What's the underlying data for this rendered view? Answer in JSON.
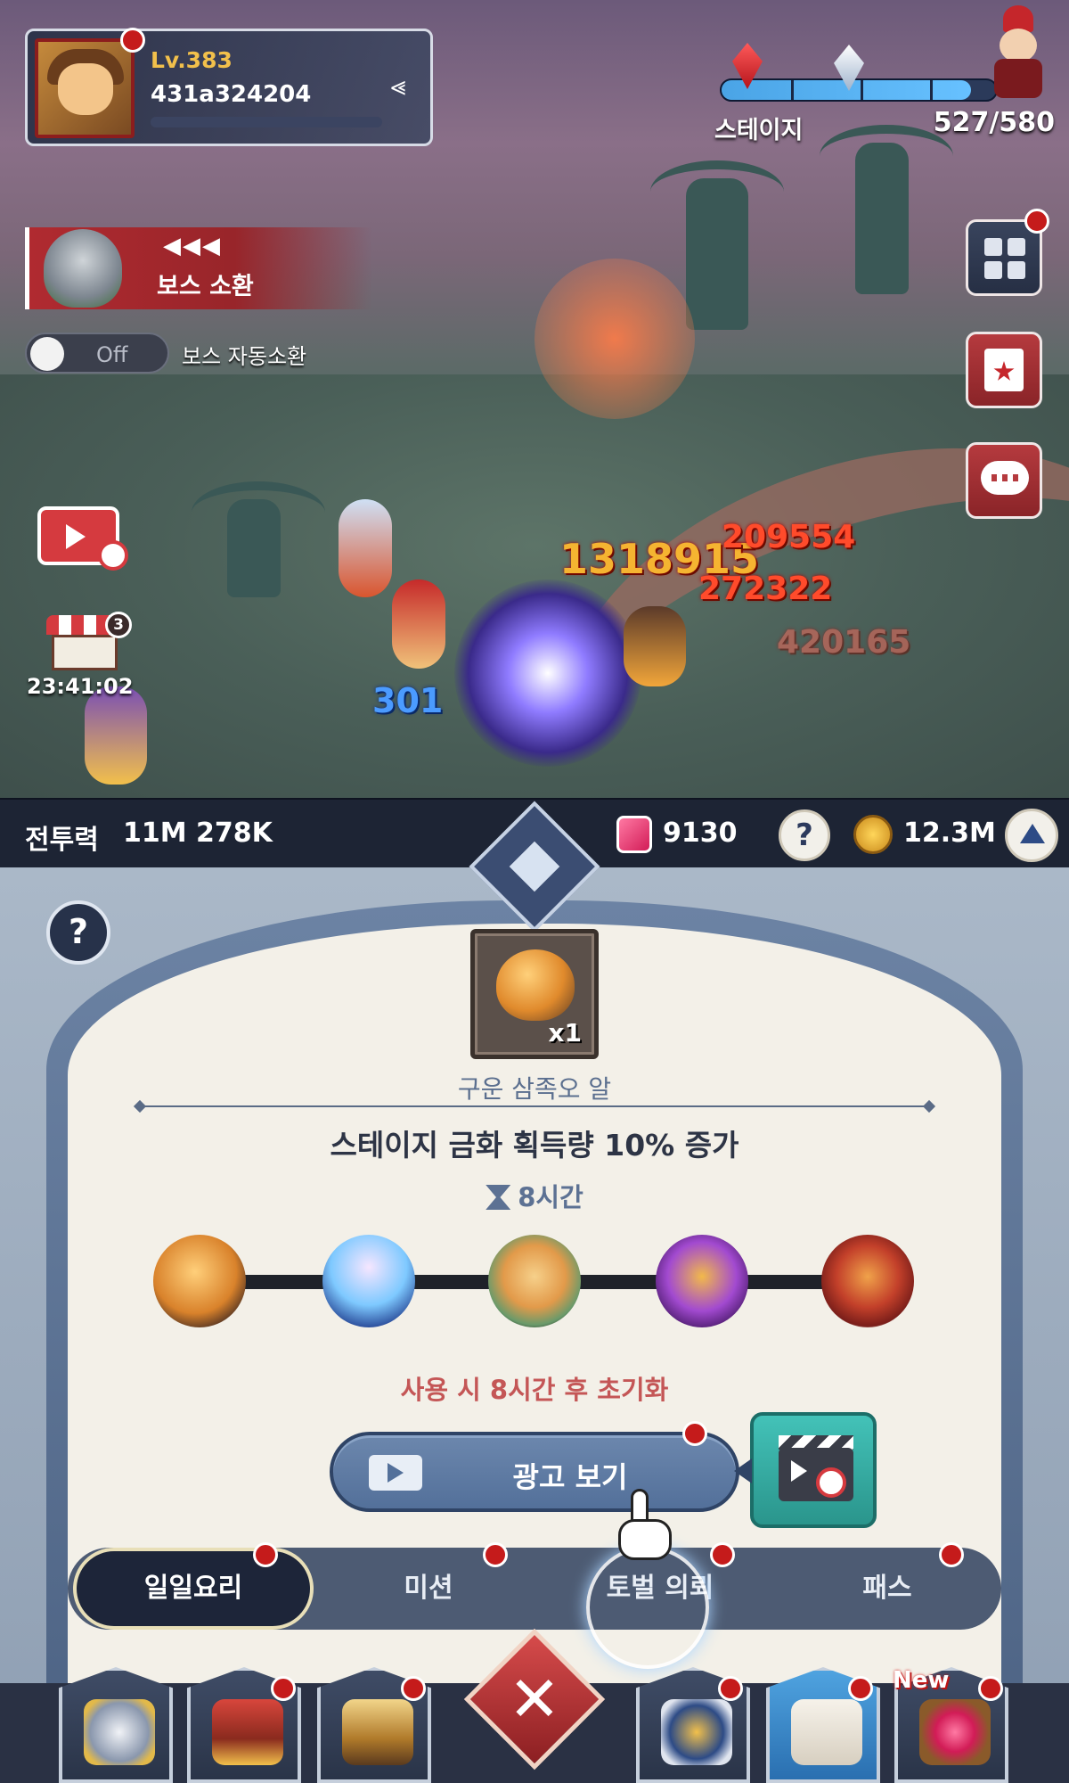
{
  "profile": {
    "level": "Lv.383",
    "user_id": "431a324204"
  },
  "stage": {
    "label": "스테이지",
    "progress_text": "527/580",
    "progress_fraction": 0.908
  },
  "boss": {
    "arrows": "◀◀◀",
    "summon_label": "보스 소환",
    "auto_toggle_state": "Off",
    "auto_label": "보스 자동소환"
  },
  "shop": {
    "badge": "3",
    "timer": "23:41:02"
  },
  "damage_numbers": [
    "1318915",
    "209554",
    "272322",
    "420165",
    "301"
  ],
  "status": {
    "combat_power_label": "전투력",
    "combat_power_value": "11M 278K",
    "gems": "9130",
    "help": "?",
    "gold": "12.3M"
  },
  "panel": {
    "help": "?",
    "item_qty": "x1",
    "item_name": "구운 삼족오 알",
    "effect": "스테이지 금화 획득량 10% 증가",
    "duration": "8시간",
    "dishes": [
      "roasted-egg-icon",
      "shaved-ice-icon",
      "soup-icon",
      "cake-icon",
      "meat-dish-icon"
    ],
    "reset_note": "사용 시 8시간 후 초기화",
    "watch_ad": "광고 보기"
  },
  "tabs": [
    {
      "label": "일일요리",
      "active": true
    },
    {
      "label": "미션",
      "active": false
    },
    {
      "label": "토벌 의뢰",
      "active": false
    },
    {
      "label": "패스",
      "active": false
    }
  ],
  "nav": {
    "items": [
      "armor-icon",
      "treasure-chest-icon",
      "spellbook-icon",
      "close-icon",
      "guild-crest-icon",
      "quest-scroll-icon",
      "gem-chest-icon"
    ],
    "new_badge": "New",
    "close": "✕"
  },
  "colors": {
    "accent_red": "#c51b1b",
    "gold_text": "#f2c04b",
    "reset_red": "#c45656",
    "teal": "#43c2b8",
    "navy": "#1d2434"
  }
}
